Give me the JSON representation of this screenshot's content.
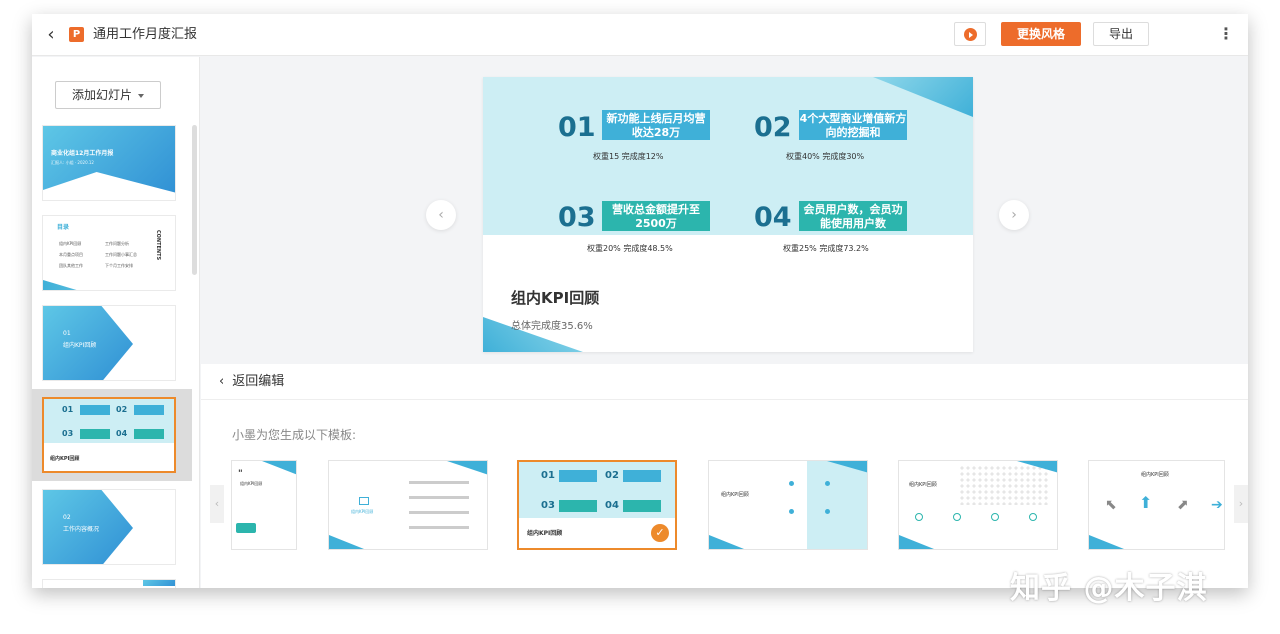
{
  "header": {
    "back_icon": "chevron-left-icon",
    "logo_letter": "P",
    "title": "通用工作月度汇报",
    "play_icon": "play-circle-icon",
    "change_style_label": "更换风格",
    "export_label": "导出",
    "more_icon": "more-vertical-icon"
  },
  "sidebar": {
    "add_slide_label": "添加幻灯片",
    "thumbnails": [
      {
        "title": "商业化组12月工作月报",
        "subtitle": "汇报人: 小组 · 2020.12"
      },
      {
        "title": "目录",
        "side": "CONTENTS",
        "items": [
          "组内KPI回顾",
          "本月重点项目",
          "团队其他工作",
          "工作问题分析",
          "工作问题小事汇总",
          "下个月工作安排"
        ]
      },
      {
        "num": "01",
        "title": "组内KPI回顾"
      },
      {
        "title": "组内KPI回顾"
      },
      {
        "num": "02",
        "title": "工作内容概况"
      }
    ]
  },
  "slide": {
    "kpis": [
      {
        "num": "01",
        "text": "新功能上线后月均营收达28万",
        "meta": "权重15  完成度12%"
      },
      {
        "num": "02",
        "text": "4个大型商业增值新方向的挖掘和",
        "meta": "权重40%  完成度30%"
      },
      {
        "num": "03",
        "text": "营收总金额提升至2500万",
        "meta": "权重20%  完成度48.5%"
      },
      {
        "num": "04",
        "text": "会员用户数，会员功能使用用户数",
        "meta": "权重25%  完成度73.2%"
      }
    ],
    "title": "组内KPI回顾",
    "subtitle": "总体完成度35.6%"
  },
  "edit_bar": {
    "back_label": "返回编辑"
  },
  "templates": {
    "hint": "小墨为您生成以下模板:",
    "items": [
      {
        "label": "组内KPI回顾"
      },
      {
        "label": "组内KPI回顾"
      },
      {
        "label": "组内KPI回顾"
      },
      {
        "label": "组内KPI回顾"
      },
      {
        "label": "组内KPI回顾"
      },
      {
        "label": "组内KPI回顾"
      }
    ]
  },
  "watermark": "知乎 @木子淇",
  "colors": {
    "accent": "#ed6c2b",
    "teal": "#2cb5ad",
    "blue": "#3fb0d8",
    "navy": "#1b6f90"
  }
}
